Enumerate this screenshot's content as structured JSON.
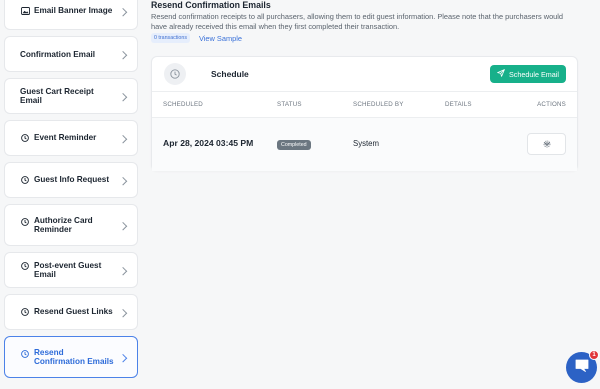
{
  "sidebar": {
    "items": [
      {
        "label": "Email Banner Image",
        "icon": "image-icon"
      },
      {
        "label": "Confirmation Email",
        "icon": ""
      },
      {
        "label": "Guest Cart Receipt Email",
        "icon": ""
      },
      {
        "label": "Event Reminder",
        "icon": "clock-icon"
      },
      {
        "label": "Guest Info Request",
        "icon": "clock-icon"
      },
      {
        "label": "Authorize Card Reminder",
        "icon": "clock-icon"
      },
      {
        "label": "Post-event Guest Email",
        "icon": "clock-icon"
      },
      {
        "label": "Resend Guest Links",
        "icon": "clock-icon"
      },
      {
        "label": "Resend Confirmation Emails",
        "icon": "clock-icon",
        "active": true
      }
    ]
  },
  "main": {
    "title": "Resend Confirmation Emails",
    "description": "Resend confirmation receipts to all purchasers, allowing them to edit guest information. Please note that the purchasers would have already received this email when they first completed their transaction.",
    "transactions_badge": "0 transactions",
    "view_sample": "View Sample"
  },
  "schedule": {
    "title": "Schedule",
    "button_label": "Schedule Email",
    "columns": {
      "scheduled": "SCHEDULED",
      "status": "STATUS",
      "scheduled_by": "SCHEDULED BY",
      "details": "DETAILS",
      "actions": "ACTIONS"
    },
    "rows": [
      {
        "scheduled": "Apr 28, 2024 03:45 PM",
        "status": "Completed",
        "scheduled_by": "System",
        "details": ""
      }
    ]
  },
  "chat": {
    "badge_count": "1"
  },
  "colors": {
    "accent": "#17b08a",
    "active_link": "#2d6bd9",
    "status_completed": "#6b7680",
    "chat_bubble": "#2c62c5",
    "notification": "#e0363a"
  }
}
